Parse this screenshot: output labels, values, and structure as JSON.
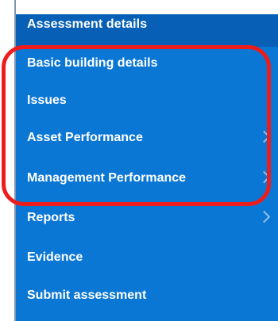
{
  "menu": {
    "header": "Assessment details",
    "items": [
      {
        "label": "Basic building details",
        "has_submenu": false
      },
      {
        "label": "Issues",
        "has_submenu": false
      },
      {
        "label": "Asset Performance",
        "has_submenu": true
      },
      {
        "label": "Management Performance",
        "has_submenu": true
      },
      {
        "label": "Reports",
        "has_submenu": true
      },
      {
        "label": "Evidence",
        "has_submenu": false
      },
      {
        "label": "Submit assessment",
        "has_submenu": false
      }
    ]
  },
  "colors": {
    "menu_background": "#0b77d5",
    "header_background": "#0760b6",
    "highlight_outline": "#ef1c1c",
    "text": "#ffffff"
  },
  "icons": [
    "chevron-right-icon"
  ]
}
